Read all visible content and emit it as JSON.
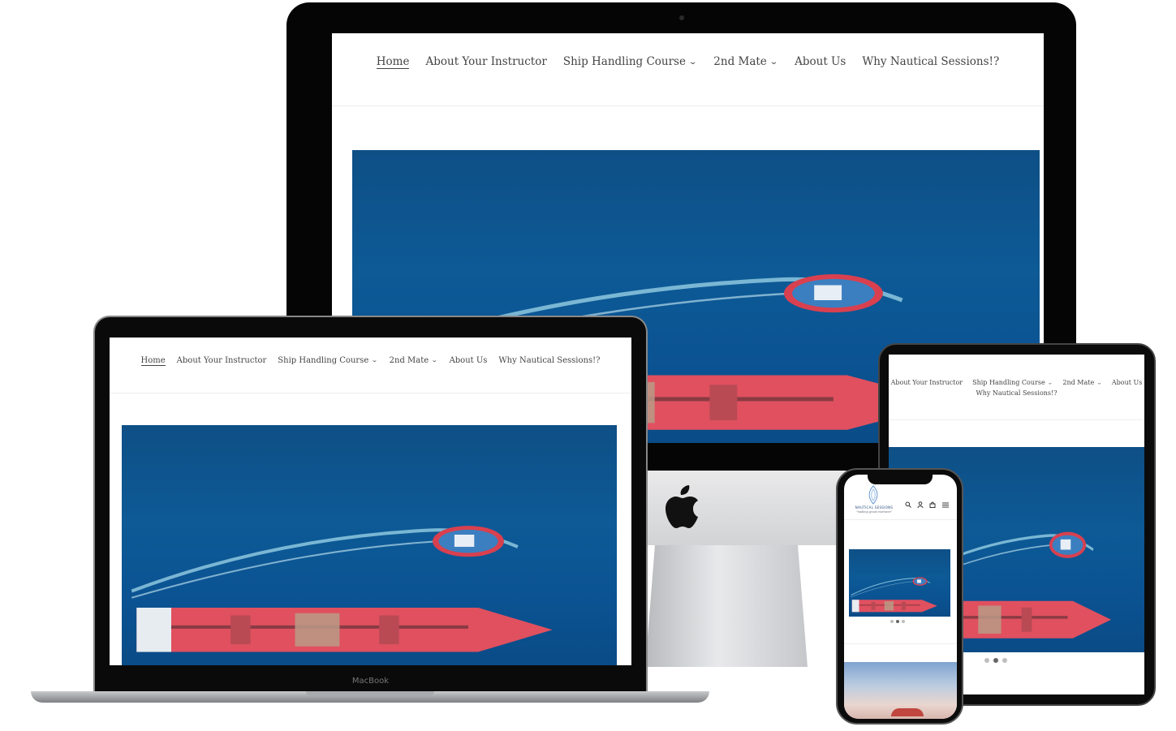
{
  "nav": {
    "home": "Home",
    "instructor": "About Your Instructor",
    "ship_handling": "Ship Handling Course",
    "second_mate": "2nd Mate",
    "about_us": "About Us",
    "why": "Why Nautical Sessions!?"
  },
  "laptop": {
    "brand_label": "MacBook"
  },
  "phone": {
    "logo_title": "NAUTICAL SESSIONS",
    "logo_tagline": "\"making great mariners\"",
    "icons": [
      "search-icon",
      "account-icon",
      "cart-icon",
      "menu-icon"
    ]
  },
  "slider": {
    "dot_count": 3,
    "active_dot": 2
  },
  "colors": {
    "sea": "#0d5a96",
    "hull": "#e0505f",
    "tug_hull": "#d9404f",
    "nav_text": "#444444"
  }
}
